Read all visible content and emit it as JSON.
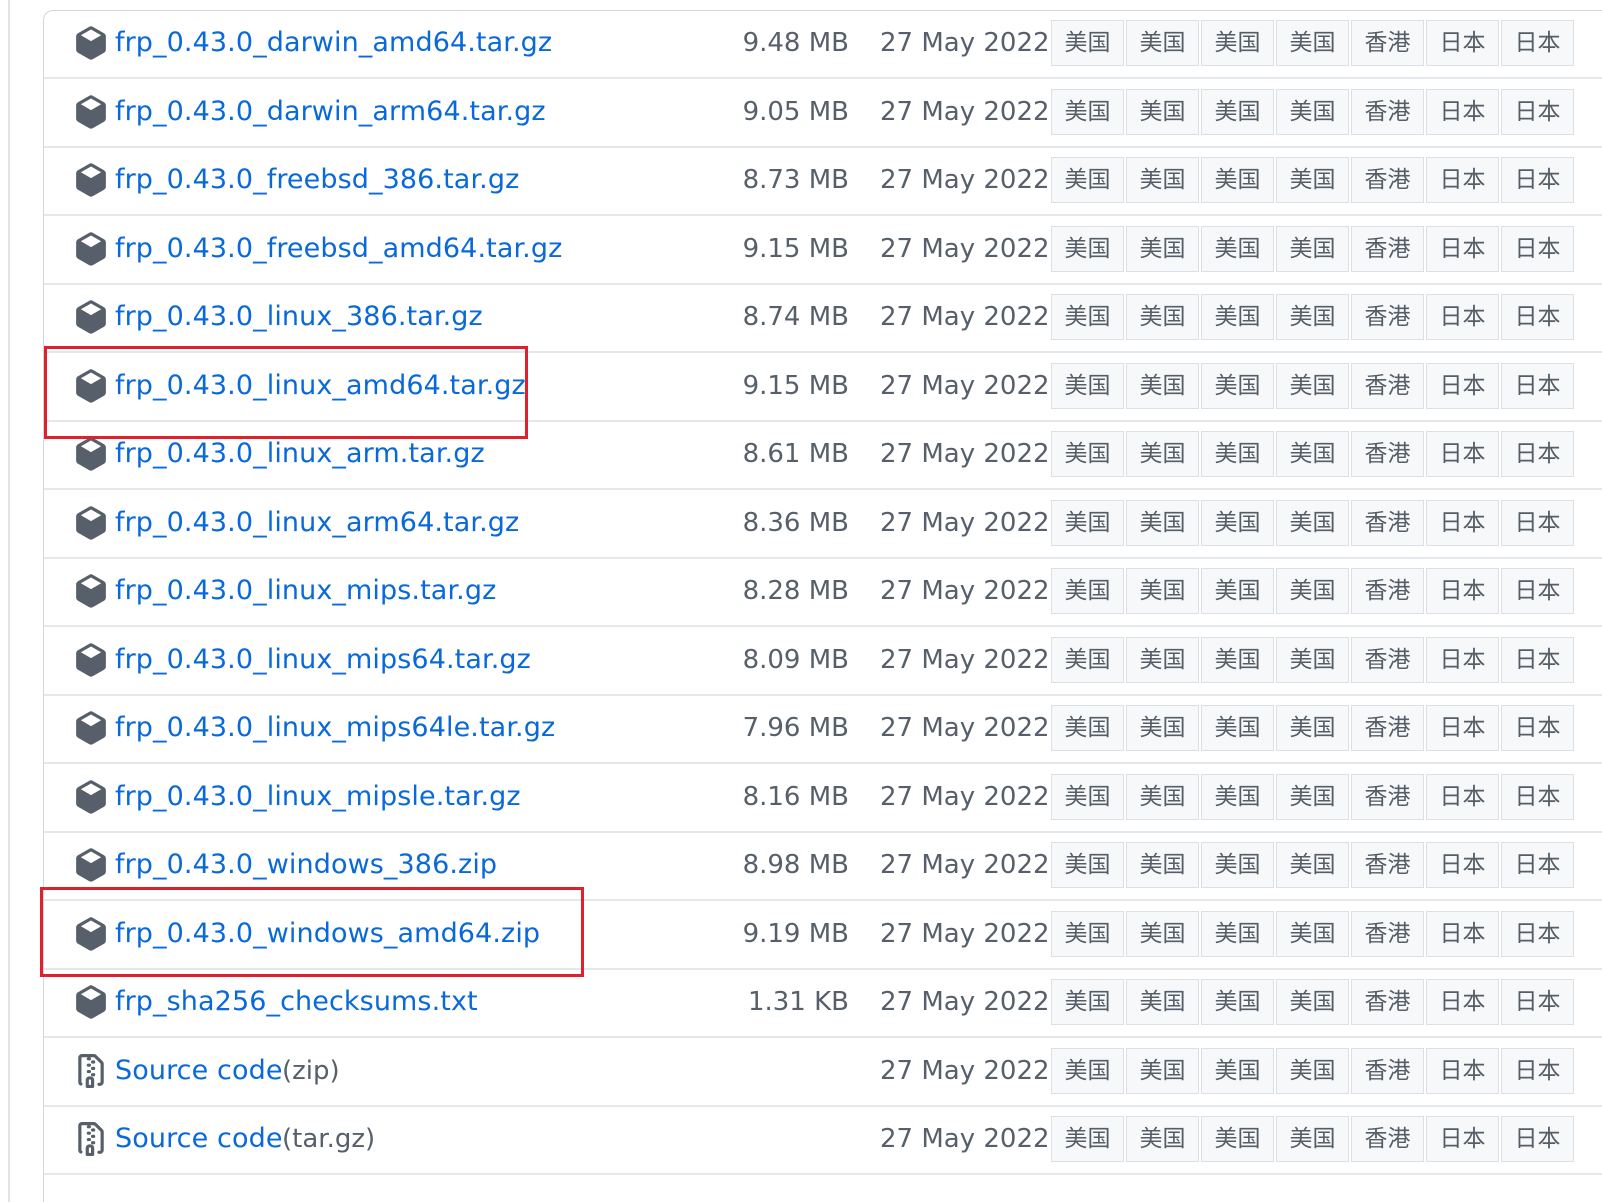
{
  "assets": [
    {
      "name": "frp_0.43.0_darwin_amd64.tar.gz",
      "size": "9.48 MB",
      "date": "27 May 2022",
      "icon": "package-icon"
    },
    {
      "name": "frp_0.43.0_darwin_arm64.tar.gz",
      "size": "9.05 MB",
      "date": "27 May 2022",
      "icon": "package-icon"
    },
    {
      "name": "frp_0.43.0_freebsd_386.tar.gz",
      "size": "8.73 MB",
      "date": "27 May 2022",
      "icon": "package-icon"
    },
    {
      "name": "frp_0.43.0_freebsd_amd64.tar.gz",
      "size": "9.15 MB",
      "date": "27 May 2022",
      "icon": "package-icon"
    },
    {
      "name": "frp_0.43.0_linux_386.tar.gz",
      "size": "8.74 MB",
      "date": "27 May 2022",
      "icon": "package-icon"
    },
    {
      "name": "frp_0.43.0_linux_amd64.tar.gz",
      "size": "9.15 MB",
      "date": "27 May 2022",
      "icon": "package-icon"
    },
    {
      "name": "frp_0.43.0_linux_arm.tar.gz",
      "size": "8.61 MB",
      "date": "27 May 2022",
      "icon": "package-icon"
    },
    {
      "name": "frp_0.43.0_linux_arm64.tar.gz",
      "size": "8.36 MB",
      "date": "27 May 2022",
      "icon": "package-icon"
    },
    {
      "name": "frp_0.43.0_linux_mips.tar.gz",
      "size": "8.28 MB",
      "date": "27 May 2022",
      "icon": "package-icon"
    },
    {
      "name": "frp_0.43.0_linux_mips64.tar.gz",
      "size": "8.09 MB",
      "date": "27 May 2022",
      "icon": "package-icon"
    },
    {
      "name": "frp_0.43.0_linux_mips64le.tar.gz",
      "size": "7.96 MB",
      "date": "27 May 2022",
      "icon": "package-icon"
    },
    {
      "name": "frp_0.43.0_linux_mipsle.tar.gz",
      "size": "8.16 MB",
      "date": "27 May 2022",
      "icon": "package-icon"
    },
    {
      "name": "frp_0.43.0_windows_386.zip",
      "size": "8.98 MB",
      "date": "27 May 2022",
      "icon": "package-icon"
    },
    {
      "name": "frp_0.43.0_windows_amd64.zip",
      "size": "9.19 MB",
      "date": "27 May 2022",
      "icon": "package-icon"
    },
    {
      "name": "frp_sha256_checksums.txt",
      "size": "1.31 KB",
      "date": "27 May 2022",
      "icon": "package-icon"
    },
    {
      "name": "Source code",
      "suffix": "(zip)",
      "size": "",
      "date": "27 May 2022",
      "icon": "file-zip-icon"
    },
    {
      "name": "Source code",
      "suffix": "(tar.gz)",
      "size": "",
      "date": "27 May 2022",
      "icon": "file-zip-icon"
    }
  ],
  "mirrors": [
    "美国",
    "美国",
    "美国",
    "美国",
    "香港",
    "日本",
    "日本"
  ],
  "highlighted_assets": [
    "frp_0.43.0_linux_amd64.tar.gz",
    "frp_0.43.0_windows_amd64.zip"
  ],
  "colors": {
    "link": "#0969da",
    "muted": "#57606a",
    "highlight": "#e0202d",
    "mirror_bg": "#f6f8fa"
  }
}
